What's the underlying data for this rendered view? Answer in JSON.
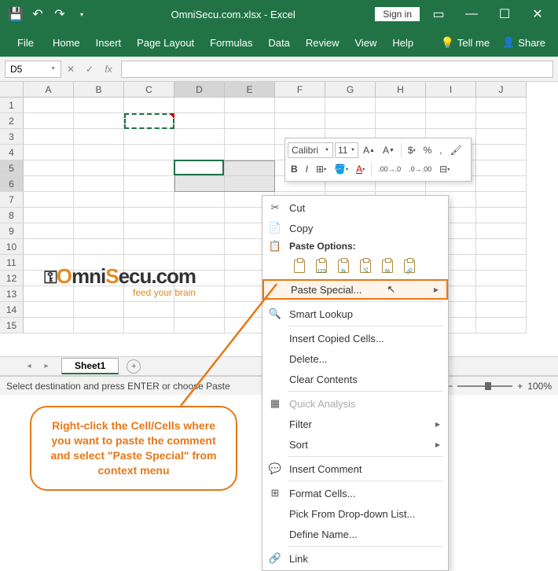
{
  "titlebar": {
    "document_name": "OmniSecu.com.xlsx",
    "app_name": "Excel",
    "signin_label": "Sign in"
  },
  "ribbon": {
    "tabs": [
      "File",
      "Home",
      "Insert",
      "Page Layout",
      "Formulas",
      "Data",
      "Review",
      "View",
      "Help"
    ],
    "tellme_label": "Tell me",
    "share_label": "Share"
  },
  "namebox": {
    "value": "D5"
  },
  "grid": {
    "columns": [
      "A",
      "B",
      "C",
      "D",
      "E",
      "F",
      "G",
      "H",
      "I",
      "J"
    ],
    "rows": [
      "1",
      "2",
      "3",
      "4",
      "5",
      "6",
      "7",
      "8",
      "9",
      "10",
      "11",
      "12",
      "13",
      "14",
      "15"
    ],
    "selected_columns": [
      "D",
      "E"
    ],
    "selected_rows": [
      "5",
      "6"
    ],
    "active_cell": "D5",
    "copied_cell": "C2"
  },
  "mini_toolbar": {
    "font": "Calibri",
    "size": "11",
    "buttons_row1": [
      "A▲",
      "A▼",
      "$",
      "%",
      ","
    ],
    "buttons_row2": [
      "B",
      "I"
    ]
  },
  "context_menu": {
    "cut": "Cut",
    "copy": "Copy",
    "paste_options_header": "Paste Options:",
    "paste_special": "Paste Special...",
    "smart_lookup": "Smart Lookup",
    "insert_copied": "Insert Copied Cells...",
    "delete": "Delete...",
    "clear_contents": "Clear Contents",
    "quick_analysis": "Quick Analysis",
    "filter": "Filter",
    "sort": "Sort",
    "insert_comment": "Insert Comment",
    "format_cells": "Format Cells...",
    "pick_dropdown": "Pick From Drop-down List...",
    "define_name": "Define Name...",
    "link": "Link",
    "paste_opt_labels": [
      "",
      "123",
      "fx",
      "⤭",
      "%",
      ""
    ]
  },
  "sheettabs": {
    "active_tab": "Sheet1"
  },
  "statusbar": {
    "message": "Select destination and press ENTER or choose Paste",
    "zoom": "100%"
  },
  "logo": {
    "brand_text": "OmniSecu.com",
    "tagline": "feed your brain"
  },
  "callout": {
    "text": "Right-click the Cell/Cells where you want to paste the comment and select \"Paste Special\" from context menu"
  }
}
